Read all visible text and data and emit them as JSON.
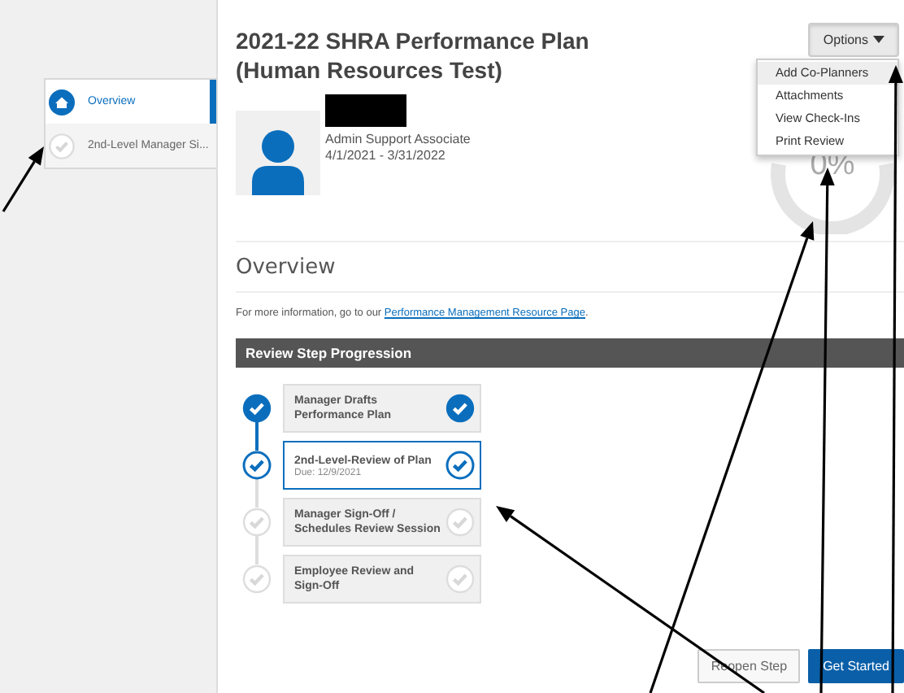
{
  "sidebar": {
    "items": [
      {
        "label": "Overview",
        "selected": true,
        "kind": "home"
      },
      {
        "label": "2nd-Level Manager Si...",
        "selected": false,
        "kind": "check"
      }
    ]
  },
  "plan": {
    "title": "2021-22 SHRA Performance Plan (Human Resources Test)",
    "position": "Admin Support Associate",
    "period": "4/1/2021 - 3/31/2022",
    "progress": "0%"
  },
  "options": {
    "label": "Options",
    "expanded": true,
    "items": [
      {
        "label": "Add Co-Planners",
        "highlighted": true
      },
      {
        "label": "Attachments",
        "highlighted": false
      },
      {
        "label": "View Check-Ins",
        "highlighted": false
      },
      {
        "label": "Print Review",
        "highlighted": false
      }
    ]
  },
  "overview": {
    "heading": "Overview",
    "info_text": "For more information, go to our",
    "link": "Performance Management Resource Page",
    "info_end": "."
  },
  "progression": {
    "title": "Review Step Progression",
    "steps": [
      {
        "title": "Manager Drafts Performance Plan",
        "completed": true,
        "selected": false
      },
      {
        "title": "2nd-Level-Review of Plan",
        "due": "Due:  12/9/2021",
        "completed": false,
        "selected": true
      },
      {
        "title": "Manager Sign-Off / Schedules Review Session",
        "completed": false,
        "selected": false
      },
      {
        "title": "Employee Review and Sign-Off",
        "completed": false,
        "selected": false
      }
    ]
  },
  "buttons": [
    {
      "label": "Reopen Step",
      "kind": "secondary"
    },
    {
      "label": "Get Started",
      "kind": "primary"
    }
  ]
}
